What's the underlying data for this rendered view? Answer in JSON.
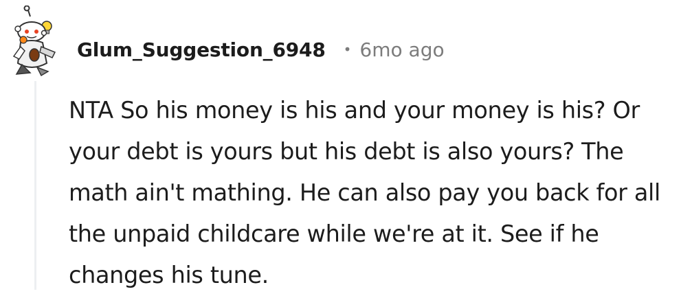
{
  "comment": {
    "author": "Glum_Suggestion_6948",
    "separator": "•",
    "timestamp": "6mo ago",
    "body": "NTA So his money is his and your money is his? Or your debt is yours but his debt is also yours? The math ain't mathing. He can also pay you back for all the unpaid childcare while we're at it. See if he changes his tune."
  },
  "colors": {
    "username": "#1c1c1c",
    "meta": "#7c7c7c",
    "thread_line": "#edeff1"
  }
}
